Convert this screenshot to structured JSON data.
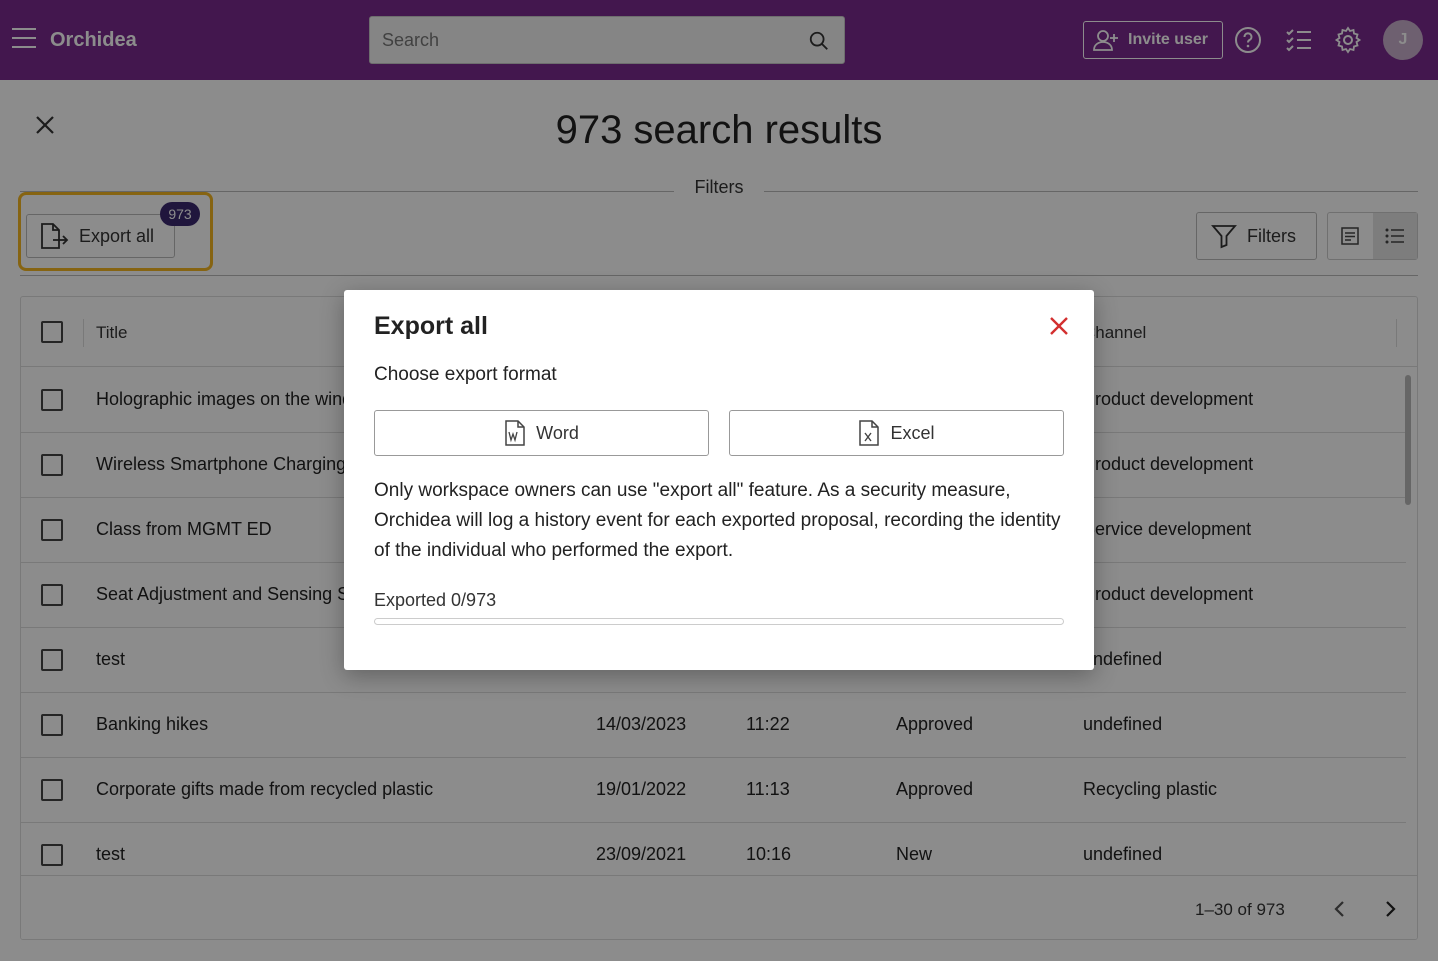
{
  "header": {
    "brand": "Orchidea",
    "search_placeholder": "Search",
    "invite_label": "Invite user",
    "avatar_initial": "J",
    "color": "#7b2a8e"
  },
  "page": {
    "title": "973 search results",
    "filters_caption": "Filters",
    "export_all_label": "Export all",
    "export_badge": "973",
    "filters_button": "Filters"
  },
  "table": {
    "headers": [
      "Title",
      "Channel"
    ],
    "rows": [
      {
        "title": "Holographic images on the windscreen",
        "date": "",
        "time": "",
        "status": "",
        "channel": "Product development"
      },
      {
        "title": "Wireless Smartphone Charging",
        "date": "",
        "time": "",
        "status": "",
        "channel": "Product development"
      },
      {
        "title": "Class from MGMT ED",
        "date": "",
        "time": "",
        "status": "",
        "channel": "Service development"
      },
      {
        "title": "Seat Adjustment and Sensing System",
        "date": "",
        "time": "",
        "status": "",
        "channel": "Product development"
      },
      {
        "title": "test",
        "date": "",
        "time": "",
        "status": "",
        "channel": "undefined"
      },
      {
        "title": "Banking hikes",
        "date": "14/03/2023",
        "time": "11:22",
        "status": "Approved",
        "channel": "undefined"
      },
      {
        "title": "Corporate gifts made from recycled plastic",
        "date": "19/01/2022",
        "time": "11:13",
        "status": "Approved",
        "channel": "Recycling plastic"
      },
      {
        "title": "test",
        "date": "23/09/2021",
        "time": "10:16",
        "status": "New",
        "channel": "undefined"
      }
    ],
    "pagination": "1–30 of 973"
  },
  "modal": {
    "title": "Export all",
    "subtitle": "Choose export format",
    "word_label": "Word",
    "excel_label": "Excel",
    "description": "Only workspace owners can use \"export all\" feature. As a security measure, Orchidea will log a history event for each exported proposal, recording the identity of the individual who performed the export.",
    "progress_label": "Exported 0/973",
    "progress_fraction": 0
  }
}
